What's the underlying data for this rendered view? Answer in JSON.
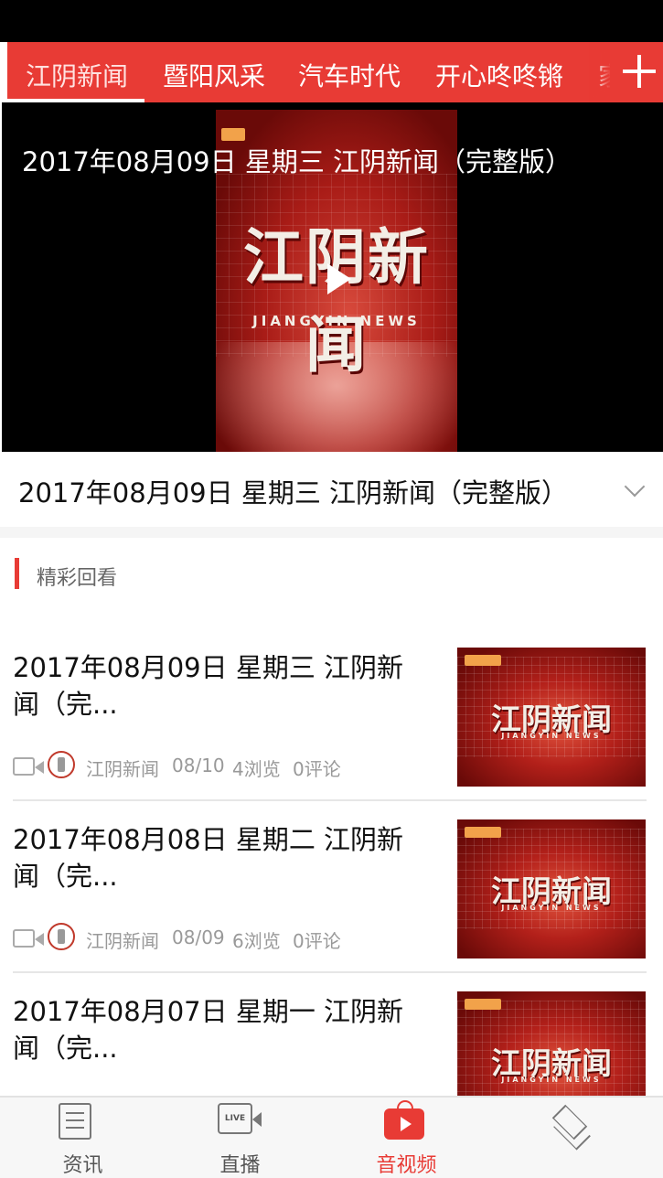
{
  "tabs": [
    "江阴新闻",
    "暨阳风采",
    "汽车时代",
    "开心咚咚锵",
    "家"
  ],
  "player": {
    "title": "2017年08月09日 星期三 江阴新闻（完整版）",
    "poster_title": "江阴新闻",
    "poster_subtitle": "JIANGYIN NEWS"
  },
  "info": {
    "title": "2017年08月09日 星期三 江阴新闻（完整版）"
  },
  "section": {
    "title": "精彩回看"
  },
  "items": [
    {
      "title": "2017年08月09日 星期三 江阴新闻（完...",
      "channel": "江阴新闻",
      "date": "08/10",
      "views": "4浏览",
      "comments": "0评论",
      "thumb_title": "江阴新闻",
      "thumb_subtitle": "JIANGYIN NEWS"
    },
    {
      "title": "2017年08月08日 星期二 江阴新闻（完...",
      "channel": "江阴新闻",
      "date": "08/09",
      "views": "6浏览",
      "comments": "0评论",
      "thumb_title": "江阴新闻",
      "thumb_subtitle": "JIANGYIN NEWS"
    },
    {
      "title": "2017年08月07日 星期一 江阴新闻（完...",
      "thumb_title": "江阴新闻",
      "thumb_subtitle": "JIANGYIN NEWS"
    }
  ],
  "bottom_nav": [
    {
      "label": "资讯",
      "icon": "news-icon"
    },
    {
      "label": "直播",
      "icon": "live-icon",
      "icon_text": "LIVE"
    },
    {
      "label": "音视频",
      "icon": "av-icon",
      "active": true
    },
    {
      "label": "",
      "icon": "layers-icon"
    }
  ],
  "colors": {
    "accent": "#e83b35",
    "meta_gray": "#999999"
  }
}
